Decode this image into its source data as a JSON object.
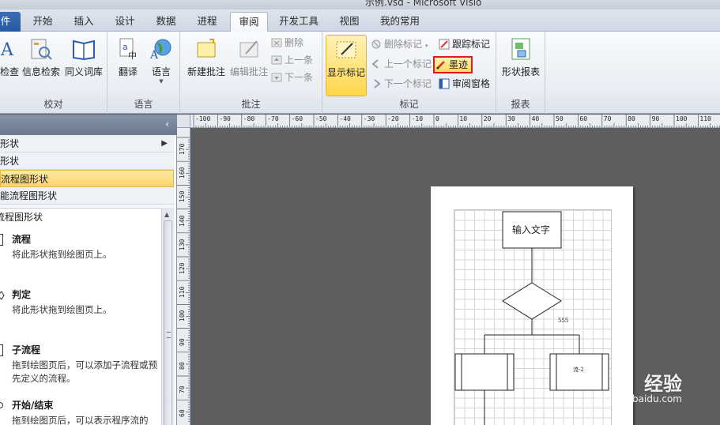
{
  "window": {
    "title": "示例.vsd - Microsoft Visio"
  },
  "tabs": [
    {
      "label": "件",
      "kind": "file"
    },
    {
      "label": "开始"
    },
    {
      "label": "插入"
    },
    {
      "label": "设计"
    },
    {
      "label": "数据"
    },
    {
      "label": "进程"
    },
    {
      "label": "审阅",
      "active": true
    },
    {
      "label": "开发工具"
    },
    {
      "label": "视图"
    },
    {
      "label": "我的常用"
    }
  ],
  "ribbon": {
    "proofing": {
      "label": "校对",
      "spell": "检查",
      "research": "信息检索",
      "thesaurus": "同义词库"
    },
    "language": {
      "label": "语言",
      "translate": "翻译",
      "language": "语言"
    },
    "comments": {
      "label": "批注",
      "new_comment": "新建批注",
      "edit_comment": "编辑批注",
      "delete": "删除",
      "previous": "上一条",
      "next": "下一条"
    },
    "markup": {
      "label": "标记",
      "show_markup": "显示标记",
      "delete_markup": "删除标记",
      "track_markup": "跟踪标记",
      "previous_markup": "上一个标记",
      "ink": "墨迹",
      "next_markup": "下一个标记",
      "reviewing_pane": "审阅窗格"
    },
    "reports": {
      "label": "报表",
      "shape_reports": "形状报表"
    }
  },
  "ruler": {
    "top": [
      "-100",
      "-90",
      "-80",
      "-70",
      "-60",
      "-50",
      "-40",
      "-30",
      "-20",
      "-10",
      "0",
      "10",
      "20",
      "30",
      "40",
      "50",
      "60",
      "70",
      "80",
      "90",
      "100",
      "110",
      "1"
    ],
    "left": [
      "170",
      "160",
      "150",
      "140",
      "130",
      "120",
      "110",
      "100",
      "90",
      "80",
      "70",
      "60"
    ]
  },
  "shapes_panel": {
    "stencils": [
      {
        "label": "形状",
        "has_arrow": true
      },
      {
        "label": "形状"
      },
      {
        "label": "流程图形状",
        "selected": true
      },
      {
        "label": "能流程图形状"
      }
    ],
    "section_title": "流程图形状",
    "items": [
      {
        "name": "流程",
        "desc": "将此形状拖到绘图页上。"
      },
      {
        "name": "判定",
        "desc": "将此形状拖到绘图页上。"
      },
      {
        "name": "子流程",
        "desc": "拖到绘图页后，可以添加子流程或预先定义的流程。"
      },
      {
        "name": "开始/结束",
        "desc": "拖到绘图页后，可以表示程序流的"
      }
    ]
  },
  "drawing": {
    "box_text": "输入文字",
    "diamond_note": "555",
    "subprocess_text": "流-2"
  },
  "watermark": {
    "brand": "经验",
    "url": "jingyan.baidu.com"
  }
}
